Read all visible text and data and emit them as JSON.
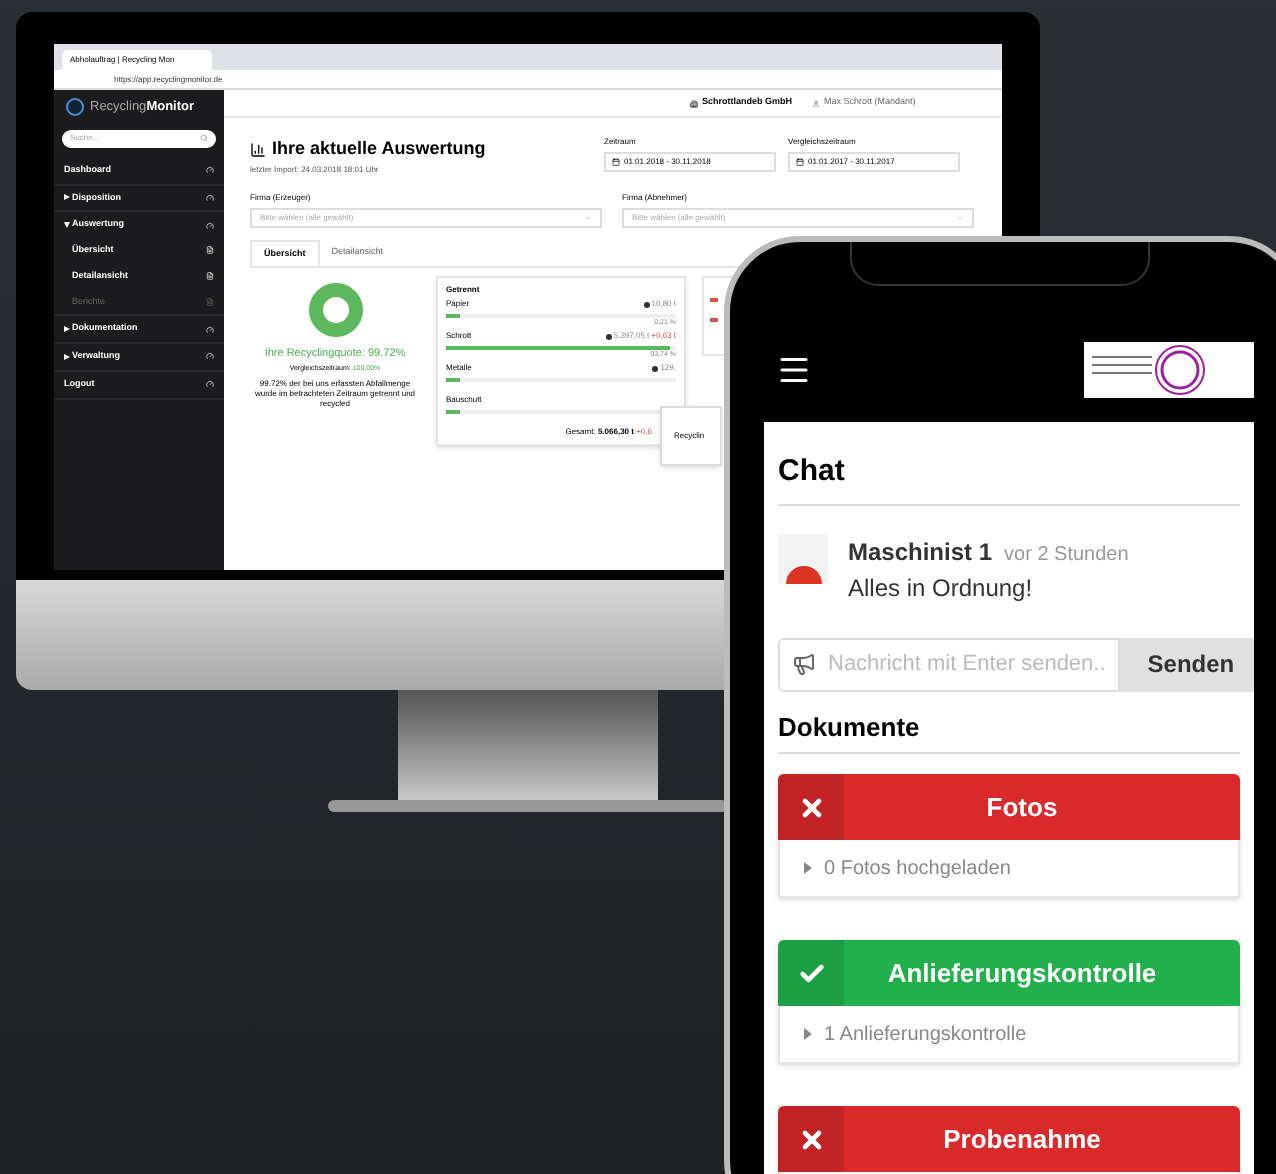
{
  "desktop": {
    "browser": {
      "tab_title": "Abholauftrag | Recycling Mon",
      "url": "https://app.recyclingmonitor.de"
    },
    "header": {
      "company": "Schrottlandeb GmbH",
      "user": "Max Schrott (Mandant)"
    },
    "sidebar": {
      "logo_light": "Recycling",
      "logo_bold": "Monitor",
      "search_placeholder": "Suche...",
      "items": [
        {
          "label": "Dashboard",
          "expandable": false,
          "disabled": false
        },
        {
          "label": "Disposition",
          "expandable": true,
          "expanded": false,
          "disabled": false
        },
        {
          "label": "Auswertung",
          "expandable": true,
          "expanded": true,
          "disabled": false,
          "children": [
            {
              "label": "Übersicht",
              "disabled": false
            },
            {
              "label": "Detailansicht",
              "disabled": false
            },
            {
              "label": "Berichte",
              "disabled": true
            }
          ]
        },
        {
          "label": "Dokumentation",
          "expandable": true,
          "expanded": false,
          "disabled": false
        },
        {
          "label": "Verwaltung",
          "expandable": true,
          "expanded": false,
          "disabled": false
        },
        {
          "label": "Logout",
          "expandable": false,
          "disabled": false
        }
      ]
    },
    "title": "Ihre aktuelle Auswertung",
    "subtitle": "letzter Import: 24.03.2018 18:01 Uhr",
    "filters": [
      {
        "label": "Zeitraum",
        "value": "01.01.2018 - 30.11.2018"
      },
      {
        "label": "Vergleichszeitraum",
        "value": "01.01.2017 - 30.11.2017"
      }
    ],
    "selects": [
      {
        "label": "Firma (Erzeuger)",
        "placeholder": "Bitte wählen (alle gewählt)"
      },
      {
        "label": "Firma (Abnehmer)",
        "placeholder": "Bitte wählen (alle gewählt)"
      }
    ],
    "tabs": [
      {
        "label": "Übersicht",
        "selected": true
      },
      {
        "label": "Detailansicht",
        "selected": false
      }
    ],
    "summary": {
      "quote": "Ihre Recyclingquote: 99.72%",
      "comparison_label": "Vergleichszeitraum:",
      "comparison_value": "100,00%",
      "text": "99.72% der bei uns erfassten Abfallmenge wurde im betrachteten Zeitraum getrennt und recycled"
    },
    "card": {
      "title": "Getrennt",
      "rows": [
        {
          "name": "Papier",
          "amount": "10,80 t",
          "share": "0,21 %",
          "level": 0.06
        },
        {
          "name": "Schrott",
          "amount": "5.397,05 t",
          "delta": "+0,63 t",
          "share": "93,74 %",
          "level": 0.97
        },
        {
          "name": "Metalle",
          "amount": "129,",
          "level": 0.06
        },
        {
          "name": "Bauschutt",
          "level": 0.06
        }
      ],
      "total_label": "Gesamt:",
      "total_value": "5.066,30 t",
      "total_delta": "+0,6"
    },
    "popup": "Recyclin"
  },
  "phone": {
    "sections": [
      {
        "kind": "chat",
        "title": "Chat",
        "message": {
          "author": "Maschinist 1",
          "time": "vor 2 Stunden",
          "text": "Alles in Ordnung!"
        },
        "placeholder": "Nachricht mit Enter senden..",
        "button": "Senden"
      },
      {
        "kind": "documents",
        "title": "Dokumente",
        "items": [
          {
            "label": "Fotos",
            "complete": false,
            "detail": "0 Fotos hochgeladen"
          },
          {
            "label": "Anlieferungskontrolle",
            "complete": true,
            "detail": "1 Anlieferungskontrolle"
          },
          {
            "label": "Probenahme",
            "complete": false
          }
        ]
      }
    ]
  }
}
